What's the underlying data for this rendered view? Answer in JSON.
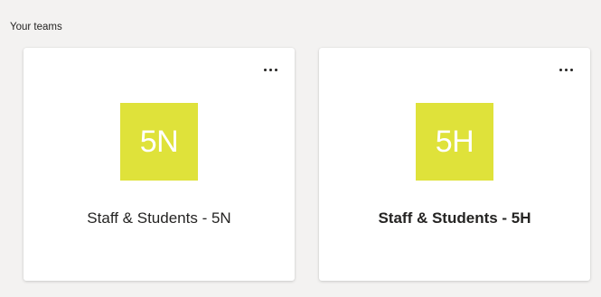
{
  "section": {
    "label": "Your teams"
  },
  "colors": {
    "background": "#f3f2f1",
    "avatar": "#dfe23a",
    "text": "#252423"
  },
  "teams": [
    {
      "initials": "5N",
      "name": "Staff & Students - 5N",
      "bold": false,
      "more_icon": "more-options-icon"
    },
    {
      "initials": "5H",
      "name": "Staff & Students - 5H",
      "bold": true,
      "more_icon": "more-options-icon"
    }
  ]
}
